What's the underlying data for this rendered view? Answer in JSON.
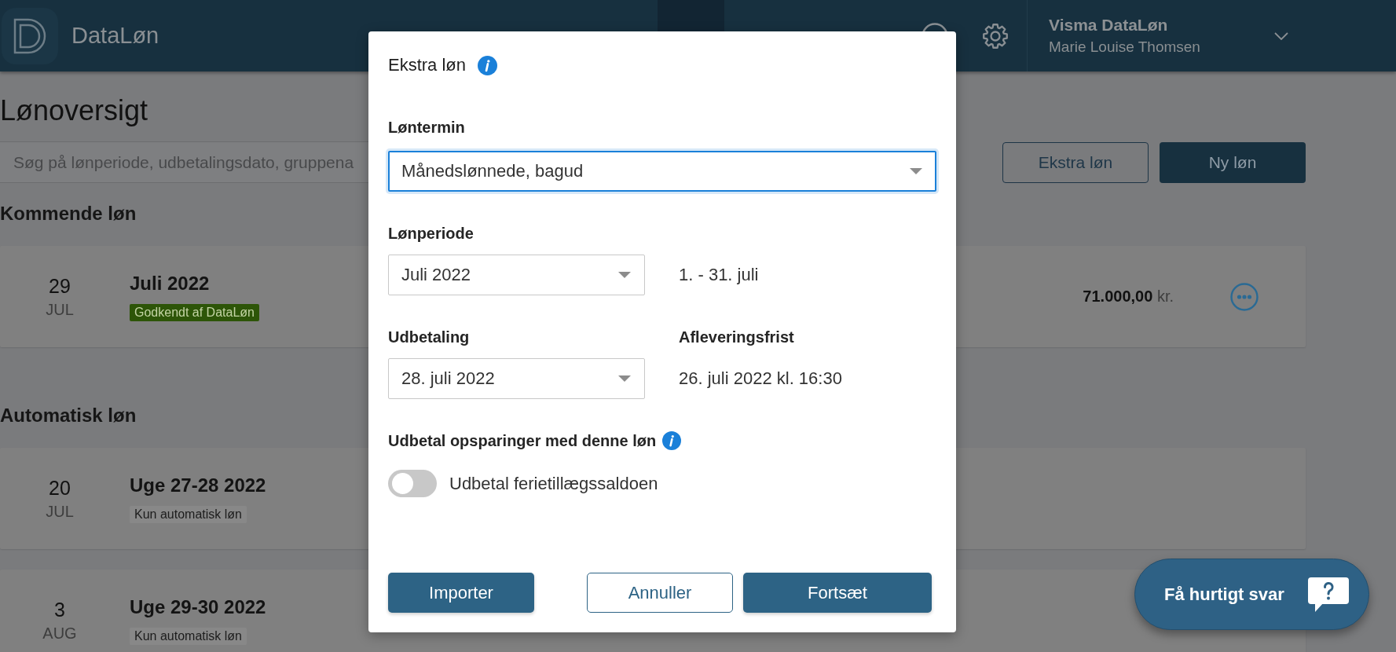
{
  "header": {
    "logo_text": "DataLøn",
    "company": "Visma DataLøn",
    "user": "Marie Louise Thomsen"
  },
  "page": {
    "title": "Lønoversigt",
    "search": {
      "placeholder": "Søg på lønperiode, udbetalingsdato, gruppena"
    },
    "actions": [
      {
        "label": "Ekstra løn",
        "kind": "outline"
      },
      {
        "label": "Ny løn",
        "kind": "primary"
      }
    ]
  },
  "sections": [
    {
      "title": "Kommende løn",
      "runs": [
        {
          "day": "29",
          "month": "JUL",
          "title": "Juli 2022",
          "badge": {
            "text": "Godkendt af DataLøn",
            "kind": "approved"
          },
          "amount": "**71.000,00** kr.",
          "menu": true
        }
      ]
    },
    {
      "title": "Automatisk løn",
      "runs": [
        {
          "day": "20",
          "month": "JUL",
          "title": "Uge 27-28 2022",
          "badge": {
            "text": "Kun automatisk løn",
            "kind": "neutral"
          },
          "menu": false
        },
        {
          "day": "3",
          "month": "AUG",
          "title": "Uge 29-30 2022",
          "badge": {
            "text": "Kun automatisk løn",
            "kind": "neutral"
          },
          "menu": false
        }
      ]
    }
  ],
  "dialog": {
    "title": "Ekstra løn",
    "term": {
      "label": "Løntermin",
      "value": "Månedslønnede, bagud",
      "focused": true
    },
    "rows": [
      {
        "left": {
          "label": "Lønperiode",
          "value": "Juli 2022",
          "focused": false
        },
        "right": {
          "text": "1. - 31. juli"
        }
      },
      {
        "left": {
          "label": "Udbetaling",
          "value": "28. juli 2022",
          "focused": false
        },
        "right": {
          "label": "Afleveringsfrist",
          "text": "26. juli 2022 kl. 16:30"
        }
      }
    ],
    "savings": {
      "title": "Udbetal opsparinger med denne løn",
      "toggle": {
        "label": "Udbetal ferietillægssaldoen",
        "on": false
      }
    },
    "buttons": [
      {
        "label": "Importer",
        "kind": "primary"
      },
      {
        "label": "Annuller",
        "kind": "outline"
      },
      {
        "label": "Fortsæt",
        "kind": "primary"
      }
    ]
  },
  "chat_button": {
    "label": "Få hurtigt svar"
  }
}
